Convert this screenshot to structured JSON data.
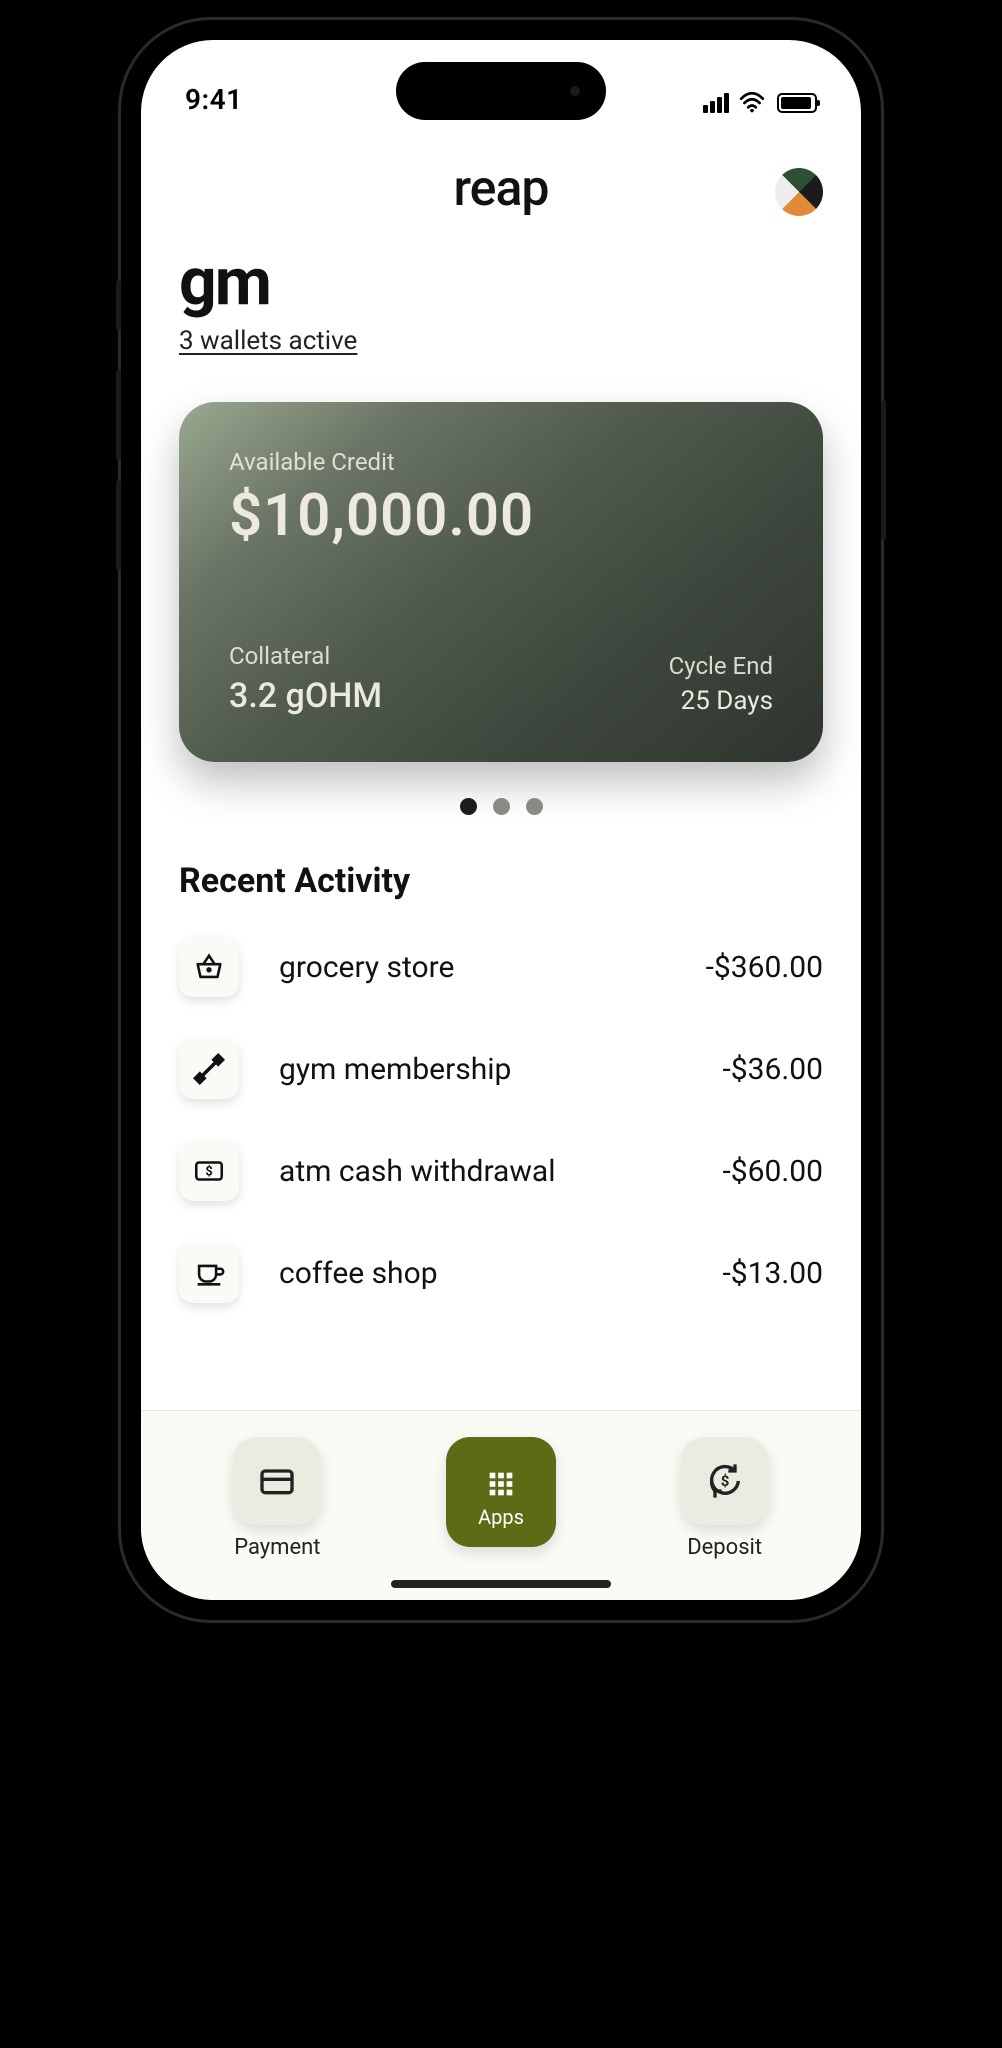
{
  "status": {
    "time": "9:41"
  },
  "header": {
    "brand": "reap"
  },
  "greeting": {
    "title": "gm",
    "wallets_link": "3 wallets active"
  },
  "card": {
    "available_label": "Available Credit",
    "available_amount": "$10,000.00",
    "collateral_label": "Collateral",
    "collateral_value": "3.2 gOHM",
    "cycle_label": "Cycle End",
    "cycle_value": "25 Days"
  },
  "carousel": {
    "dots": 3,
    "active": 0
  },
  "recent_title": "Recent Activity",
  "activities": [
    {
      "icon": "basket-icon",
      "label": "grocery store",
      "amount": "-$360.00"
    },
    {
      "icon": "dumbbell-icon",
      "label": "gym membership",
      "amount": "-$36.00"
    },
    {
      "icon": "cash-icon",
      "label": "atm cash withdrawal",
      "amount": "-$60.00"
    },
    {
      "icon": "coffee-icon",
      "label": "coffee shop",
      "amount": "-$13.00"
    }
  ],
  "nav": {
    "payment": "Payment",
    "apps": "Apps",
    "deposit": "Deposit"
  }
}
